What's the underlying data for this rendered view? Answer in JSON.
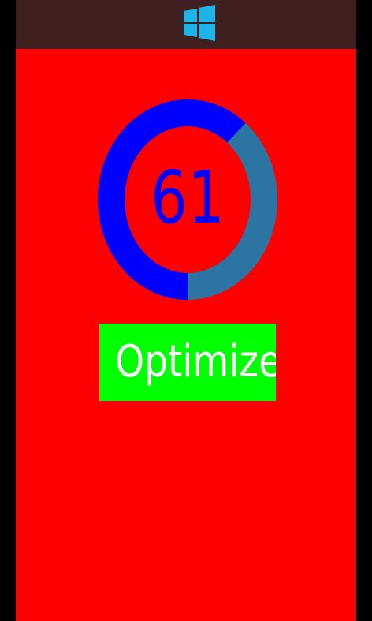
{
  "colors": {
    "frame": "#000000",
    "header": "#3f1f1f",
    "background": "#ff0000",
    "gauge_fill": "#0000ff",
    "gauge_track": "#2c75a3",
    "score_text": "#0000ff",
    "button_bg": "#00ff00",
    "button_text": "#ffffff",
    "windows_logo": "#1db4ea"
  },
  "header": {
    "logo_icon": "windows-logo-icon"
  },
  "gauge": {
    "score": "61",
    "fraction": 0.61
  },
  "actions": {
    "optimize_label": "Optimize"
  }
}
